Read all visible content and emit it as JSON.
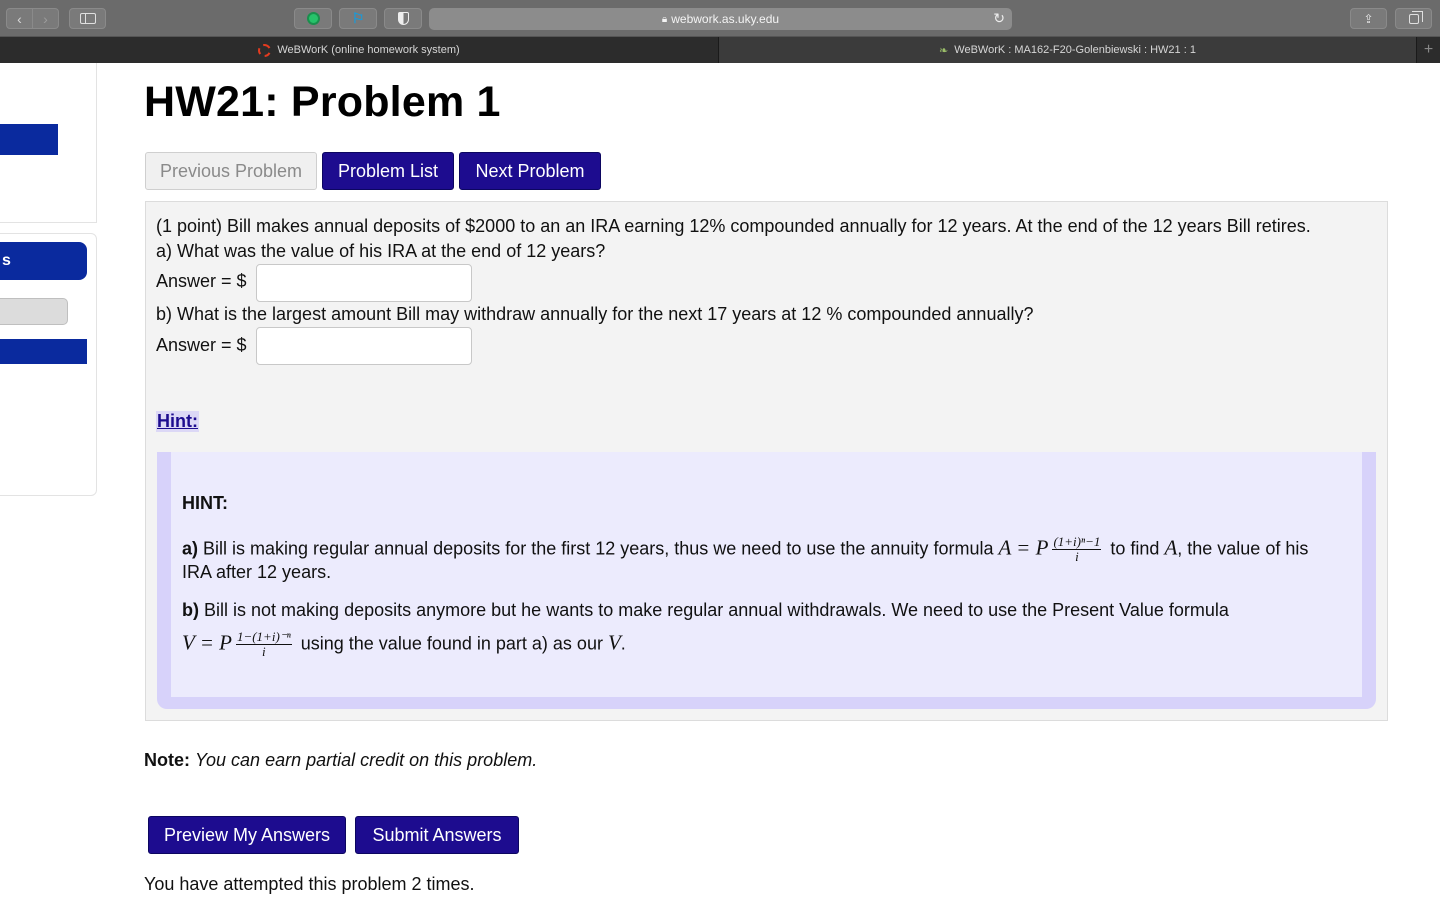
{
  "browser": {
    "url": "webwork.as.uky.edu",
    "tabs": [
      {
        "title": "WeBWorK (online homework system)"
      },
      {
        "title": "WeBWorK : MA162-F20-Golenbiewski : HW21 : 1"
      }
    ],
    "new_tab_label": "+"
  },
  "sidebar": {
    "pill_label": "s"
  },
  "page": {
    "title": "HW21: Problem 1"
  },
  "nav": {
    "previous": "Previous Problem",
    "list": "Problem List",
    "next": "Next Problem"
  },
  "problem": {
    "intro": "(1 point) Bill makes annual deposits of $2000 to an an IRA earning 12% compounded annually for 12 years. At the end of the 12 years Bill retires.",
    "part_a": "a) What was the value of his IRA at the end of 12 years?",
    "answer_label": "Answer = $",
    "answer_a_value": "",
    "part_b": "b) What is the largest amount Bill may withdraw annually for the next 17 years at 12 % compounded annually?",
    "answer_b_value": ""
  },
  "hint": {
    "toggle_label": "Hint:",
    "heading": "HINT:",
    "a_label": "a)",
    "a_text_before": "Bill is making regular annual deposits for the first 12 years, thus we need to use the annuity formula",
    "a_formula_lhs": "A = P",
    "a_frac_num": "(1+i)ⁿ−1",
    "a_frac_den": "i",
    "a_text_mid": "to find",
    "a_var": "A",
    "a_text_after": ", the value of his",
    "a_text_line2": "IRA after 12 years.",
    "b_label": "b)",
    "b_text": "Bill is not making deposits anymore but he wants to make regular annual withdrawals. We need to use the Present Value formula",
    "b_formula_lhs": "V = P",
    "b_frac_num": "1−(1+i)⁻ⁿ",
    "b_frac_den": "i",
    "b_text_after": "using the value found in part a) as our",
    "b_var": "V",
    "b_period": "."
  },
  "note": {
    "label": "Note:",
    "text": "You can earn partial credit on this problem."
  },
  "actions": {
    "preview": "Preview My Answers",
    "submit": "Submit Answers"
  },
  "status": {
    "attempts": "You have attempted this problem 2 times."
  },
  "colors": {
    "primary_button": "#1d0c8f",
    "hint_frame": "#d7d2fa",
    "hint_bg": "#ecebfd",
    "sidebar_blue": "#0a2a9e"
  }
}
